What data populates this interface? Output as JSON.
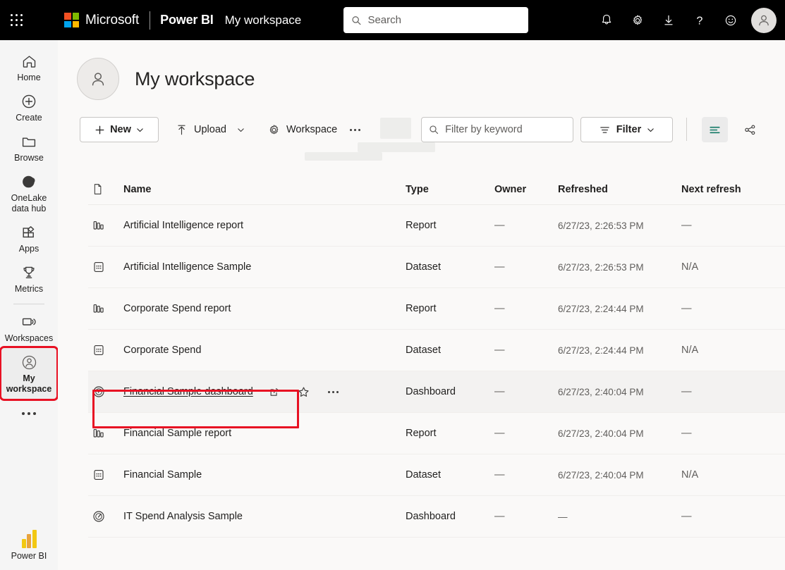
{
  "header": {
    "waffle_label": "app-launcher",
    "microsoft": "Microsoft",
    "product": "Power BI",
    "breadcrumb": "My workspace",
    "search_placeholder": "Search",
    "search_value": "",
    "actions": [
      {
        "name": "notifications-icon",
        "label": "Notifications"
      },
      {
        "name": "settings-gear-icon",
        "label": "Settings"
      },
      {
        "name": "download-icon",
        "label": "Download"
      },
      {
        "name": "help-question-icon",
        "label": "Help"
      },
      {
        "name": "feedback-smiley-icon",
        "label": "Feedback"
      }
    ],
    "avatar_label": "Account manager"
  },
  "sidebar": {
    "items": [
      {
        "label": "Home",
        "icon": "home-icon"
      },
      {
        "label": "Create",
        "icon": "create-plus-icon"
      },
      {
        "label": "Browse",
        "icon": "browse-folder-icon"
      },
      {
        "label": "OneLake\ndata hub",
        "line1": "OneLake",
        "line2": "data hub",
        "icon": "onelake-icon"
      },
      {
        "label": "Apps",
        "icon": "apps-icon"
      },
      {
        "label": "Metrics",
        "icon": "metrics-trophy-icon"
      },
      {
        "label": "Workspaces",
        "icon": "workspaces-icon"
      },
      {
        "label": "My\nworkspace",
        "line1": "My",
        "line2": "workspace",
        "icon": "my-workspace-person-icon",
        "selected": true
      }
    ],
    "more_label": "More options",
    "footer_label": "Power BI"
  },
  "workspace": {
    "title": "My workspace",
    "avatar_name": "workspace-avatar"
  },
  "toolbar": {
    "new_label": "New",
    "upload_label": "Upload",
    "workspace_settings_label": "Workspace",
    "more_label": "More options",
    "filter_placeholder": "Filter by keyword",
    "filter_value": "",
    "filter_button_label": "Filter",
    "view_toggle_label": "List view",
    "lineage_label": "Lineage view",
    "accent_color": "#117865"
  },
  "table": {
    "columns": [
      {
        "key": "icon",
        "label": ""
      },
      {
        "key": "name",
        "label": "Name"
      },
      {
        "key": "type",
        "label": "Type"
      },
      {
        "key": "owner",
        "label": "Owner"
      },
      {
        "key": "refreshed",
        "label": "Refreshed"
      },
      {
        "key": "next_refresh",
        "label": "Next refresh"
      }
    ],
    "rows": [
      {
        "icon": "report-icon",
        "name": "Artificial Intelligence report",
        "type": "Report",
        "owner": "—",
        "refreshed": "6/27/23, 2:26:53 PM",
        "next_refresh": "—",
        "highlighted": false,
        "show_actions": false
      },
      {
        "icon": "dataset-icon",
        "name": "Artificial Intelligence Sample",
        "type": "Dataset",
        "owner": "—",
        "refreshed": "6/27/23, 2:26:53 PM",
        "next_refresh": "N/A",
        "highlighted": false,
        "show_actions": false
      },
      {
        "icon": "report-icon",
        "name": "Corporate Spend report",
        "type": "Report",
        "owner": "—",
        "refreshed": "6/27/23, 2:24:44 PM",
        "next_refresh": "—",
        "highlighted": false,
        "show_actions": false
      },
      {
        "icon": "dataset-icon",
        "name": "Corporate Spend",
        "type": "Dataset",
        "owner": "—",
        "refreshed": "6/27/23, 2:24:44 PM",
        "next_refresh": "N/A",
        "highlighted": false,
        "show_actions": false
      },
      {
        "icon": "dashboard-icon",
        "name": "Financial Sample dashboard",
        "type": "Dashboard",
        "owner": "—",
        "refreshed": "6/27/23, 2:40:04 PM",
        "next_refresh": "—",
        "highlighted": true,
        "show_actions": true
      },
      {
        "icon": "report-icon",
        "name": "Financial Sample report",
        "type": "Report",
        "owner": "—",
        "refreshed": "6/27/23, 2:40:04 PM",
        "next_refresh": "—",
        "highlighted": false,
        "show_actions": false
      },
      {
        "icon": "dataset-icon",
        "name": "Financial Sample",
        "type": "Dataset",
        "owner": "—",
        "refreshed": "6/27/23, 2:40:04 PM",
        "next_refresh": "N/A",
        "highlighted": false,
        "show_actions": false
      },
      {
        "icon": "dashboard-icon",
        "name": "IT Spend Analysis Sample",
        "type": "Dashboard",
        "owner": "—",
        "refreshed": "—",
        "next_refresh": "—",
        "highlighted": false,
        "show_actions": false
      }
    ],
    "row_actions": [
      {
        "name": "share-icon",
        "label": "Share"
      },
      {
        "name": "favorite-star-icon",
        "label": "Favorite"
      },
      {
        "name": "more-options-icon",
        "label": "More options"
      }
    ]
  },
  "annotation": {
    "color": "#e81123",
    "target": "Financial Sample dashboard"
  }
}
